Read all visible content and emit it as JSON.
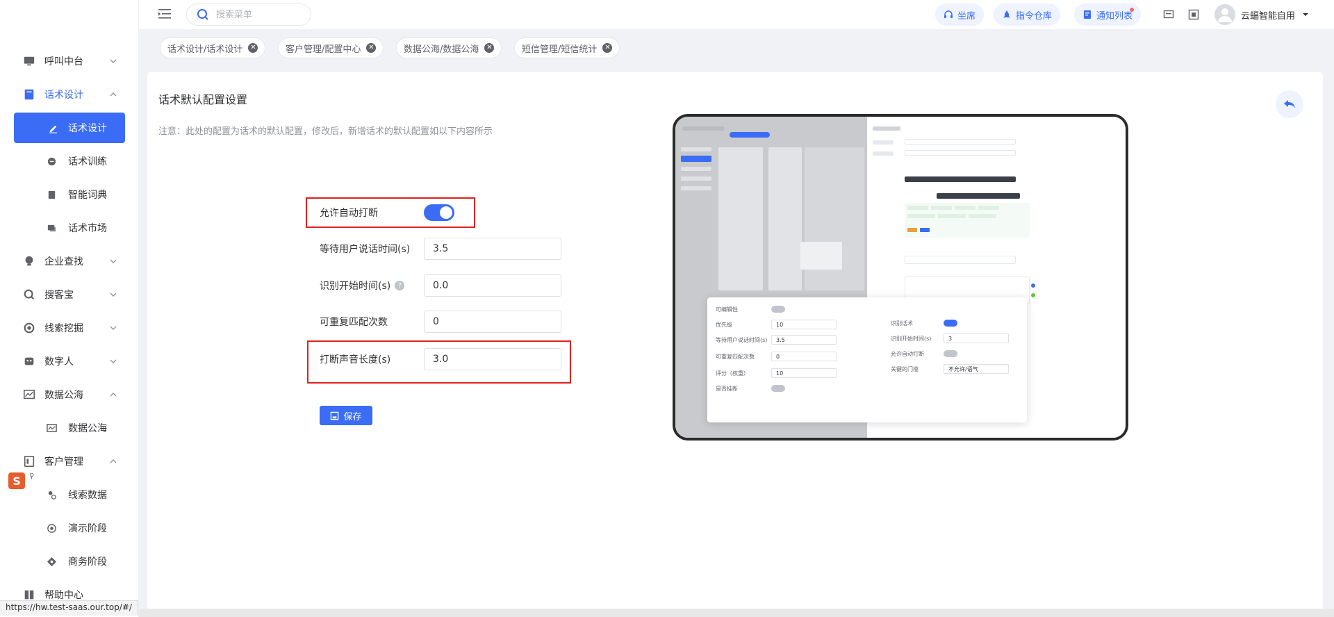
{
  "sidebar": {
    "items": [
      {
        "label": "呼叫中台",
        "icon": "monitor-icon",
        "expanded": false
      },
      {
        "label": "话术设计",
        "icon": "book-icon",
        "expanded": true
      },
      {
        "label": "话术设计",
        "icon": "edit-icon",
        "sub": true,
        "selected": true
      },
      {
        "label": "话术训练",
        "icon": "chat-icon",
        "sub": true
      },
      {
        "label": "智能词典",
        "icon": "dictionary-icon",
        "sub": true
      },
      {
        "label": "话术市场",
        "icon": "market-icon",
        "sub": true
      },
      {
        "label": "企业查找",
        "icon": "bulb-icon",
        "expanded": false
      },
      {
        "label": "搜客宝",
        "icon": "search-plus-icon",
        "expanded": false
      },
      {
        "label": "线索挖掘",
        "icon": "target-icon",
        "expanded": false
      },
      {
        "label": "数字人",
        "icon": "robot-icon",
        "expanded": false
      },
      {
        "label": "数据公海",
        "icon": "chart-icon",
        "expanded": true
      },
      {
        "label": "数据公海",
        "icon": "chart-icon",
        "sub": true
      },
      {
        "label": "客户管理",
        "icon": "customer-icon",
        "expanded": true
      },
      {
        "label": "线索数据",
        "icon": "lead-icon",
        "sub": true
      },
      {
        "label": "演示阶段",
        "icon": "stage-icon",
        "sub": true
      },
      {
        "label": "商务阶段",
        "icon": "business-icon",
        "sub": true
      },
      {
        "label": "帮助中心",
        "icon": "help-icon",
        "expanded": false
      }
    ]
  },
  "topbar": {
    "search_placeholder": "搜索菜单",
    "btn_seat": "坐席",
    "btn_command": "指令仓库",
    "btn_notice": "通知列表",
    "user_name": "云蝠智能自用"
  },
  "tabs": [
    {
      "label": "话术设计/话术设计"
    },
    {
      "label": "客户管理/配置中心"
    },
    {
      "label": "数据公海/数据公海"
    },
    {
      "label": "短信管理/短信统计"
    }
  ],
  "page": {
    "title": "话术默认配置设置",
    "notice": "注意：此处的配置为话术的默认配置，修改后，新增话术的默认配置如以下内容所示",
    "fields": {
      "auto_interrupt_label": "允许自动打断",
      "auto_interrupt_on": true,
      "wait_label": "等待用户说话时间(s)",
      "wait_value": "3.5",
      "recog_label": "识别开始时间(s)",
      "recog_value": "0.0",
      "repeat_label": "可重复匹配次数",
      "repeat_value": "0",
      "interrupt_len_label": "打断声音长度(s)",
      "interrupt_len_value": "3.0"
    },
    "save_label": "保存"
  },
  "preview_popup": {
    "row1": "可编辑性",
    "row2_label": "优先级",
    "row2_value": "10",
    "row3_label": "等待用户说话时间(s)",
    "row3_value": "3.5",
    "row4_label": "可重复匹配次数",
    "row4_value": "0",
    "row5_label": "评分（权重）",
    "row5_value": "10",
    "row6_label": "是否挂断",
    "r1_label": "识别话术",
    "r2_label": "识别开始时间(s)",
    "r2_value": "3",
    "r3_label": "允许自动打断",
    "r4_label": "关键的门槛",
    "r4_value": "不允许/语气"
  },
  "status_url": "https://hw.test-saas.our.top/#/"
}
